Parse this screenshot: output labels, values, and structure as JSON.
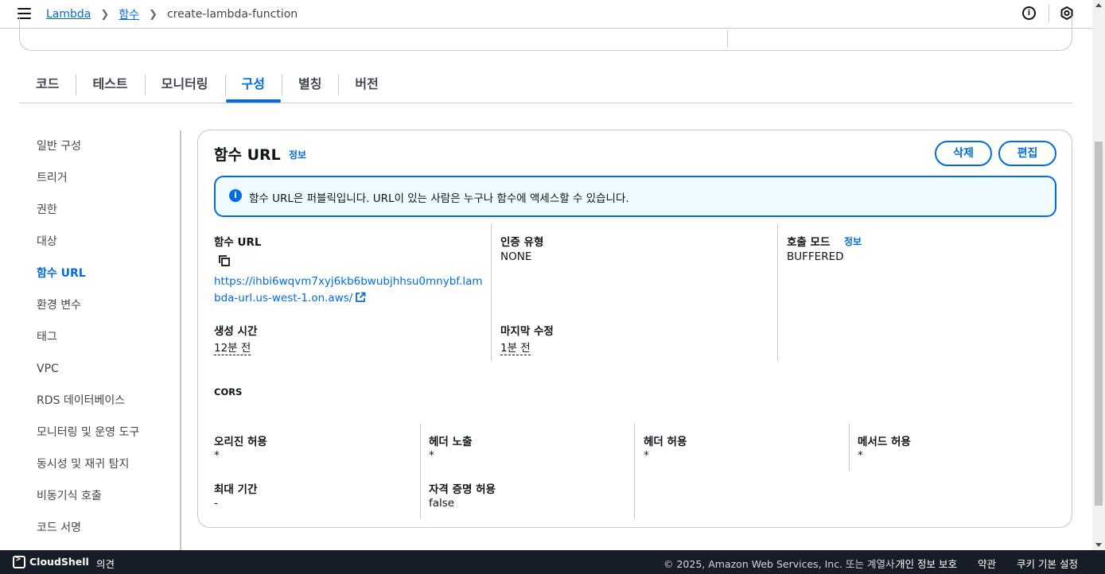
{
  "breadcrumb": {
    "items": [
      "Lambda",
      "함수"
    ],
    "current": "create-lambda-function"
  },
  "tabs": [
    {
      "label": "코드"
    },
    {
      "label": "테스트"
    },
    {
      "label": "모니터링"
    },
    {
      "label": "구성",
      "active": true
    },
    {
      "label": "별칭"
    },
    {
      "label": "버전"
    }
  ],
  "sidenav": {
    "items": [
      {
        "label": "일반 구성"
      },
      {
        "label": "트리거"
      },
      {
        "label": "권한"
      },
      {
        "label": "대상"
      },
      {
        "label": "함수 URL",
        "active": true
      },
      {
        "label": "환경 변수"
      },
      {
        "label": "태그"
      },
      {
        "label": "VPC"
      },
      {
        "label": "RDS 데이터베이스"
      },
      {
        "label": "모니터링 및 운영 도구"
      },
      {
        "label": "동시성 및 재귀 탐지"
      },
      {
        "label": "비동기식 호출"
      },
      {
        "label": "코드 서명"
      }
    ]
  },
  "panel": {
    "title": "함수 URL",
    "info_label": "정보",
    "delete_label": "삭제",
    "edit_label": "편집",
    "alert_text": "함수 URL은 퍼블릭입니다. URL이 있는 사람은 누구나 함수에 액세스할 수 있습니다.",
    "function_url_label": "함수 URL",
    "function_url": "https://ihbi6wqvm7xyj6kb6bwubjhhsu0mnybf.lambda-url.us-west-1.on.aws/",
    "auth_type_label": "인증 유형",
    "auth_type": "NONE",
    "invoke_mode_label": "호출 모드",
    "invoke_mode_info": "정보",
    "invoke_mode": "BUFFERED",
    "created_label": "생성 시간",
    "created": "12분 전",
    "modified_label": "마지막 수정",
    "modified": "1분 전",
    "cors_label": "CORS",
    "allow_origin_label": "오리진 허용",
    "allow_origin": "*",
    "expose_headers_label": "헤더 노출",
    "expose_headers": "*",
    "allow_headers_label": "헤더 허용",
    "allow_headers": "*",
    "allow_methods_label": "메서드 허용",
    "allow_methods": "*",
    "max_age_label": "최대 기간",
    "max_age": "-",
    "allow_credentials_label": "자격 증명 허용",
    "allow_credentials": "false"
  },
  "footer": {
    "cloudshell": "CloudShell",
    "feedback": "의견",
    "copyright": "© 2025, Amazon Web Services, Inc. 또는 계열사.",
    "privacy": "개인 정보 보호",
    "terms": "약관",
    "cookies": "쿠키 기본 설정"
  },
  "colors": {
    "accent": "#006ce0",
    "footer_bg": "#161d26",
    "alert_bg": "#f0fbff",
    "border": "#c6c6cd"
  },
  "icons": [
    "menu-icon",
    "info-icon",
    "settings-icon",
    "copy-icon",
    "external-link-icon",
    "cloudshell-icon"
  ]
}
